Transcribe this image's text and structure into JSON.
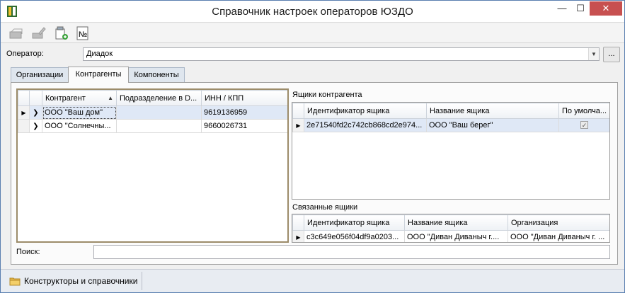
{
  "window": {
    "title": "Справочник настроек операторов ЮЗДО",
    "minimize_glyph": "—",
    "maximize_glyph": "☐",
    "close_glyph": "✕"
  },
  "toolbar": {
    "buttons": [
      {
        "name": "toolbar-open-icon",
        "enabled": false
      },
      {
        "name": "toolbar-edit-icon",
        "enabled": false
      },
      {
        "name": "toolbar-add-icon",
        "enabled": true
      },
      {
        "name": "toolbar-number-icon",
        "enabled": true
      }
    ]
  },
  "operator": {
    "label": "Оператор:",
    "value": "Диадок",
    "ellipsis": "..."
  },
  "tabs": [
    {
      "label": "Организации",
      "active": false
    },
    {
      "label": "Контрагенты",
      "active": true
    },
    {
      "label": "Компоненты",
      "active": false
    }
  ],
  "contractors": {
    "columns": [
      "Контрагент",
      "Подразделение в D...",
      "ИНН / КПП"
    ],
    "sort_column": "Контрагент",
    "rows": [
      {
        "name": "ООО \"Ваш дом\"",
        "division": "",
        "inn": "9619136959"
      },
      {
        "name": "ООО \"Солнечны...",
        "division": "",
        "inn": "9660026731"
      }
    ]
  },
  "boxes": {
    "title": "Ящики контрагента",
    "columns": [
      "Идентификатор ящика",
      "Название ящика",
      "По умолча..."
    ],
    "rows": [
      {
        "id": "2e71540fd2c742cb868cd2e974...",
        "name": "ООО \"Ваш берег\"",
        "default": true
      }
    ]
  },
  "linked_boxes": {
    "title": "Связанные ящики",
    "columns": [
      "Идентификатор ящика",
      "Название ящика",
      "Организация"
    ],
    "rows": [
      {
        "id": "c3c649e056f04df9a0203...",
        "name": "ООО \"Диван Диваныч г....",
        "org": "ООО \"Диван Диваныч г. ..."
      }
    ]
  },
  "search": {
    "label": "Поиск:",
    "value": ""
  },
  "statusbar": {
    "item_label": "Конструкторы и справочники"
  },
  "colors": {
    "accent": "#5a7fb0",
    "selection": "#dfe8f6",
    "close_button": "#c75050"
  }
}
